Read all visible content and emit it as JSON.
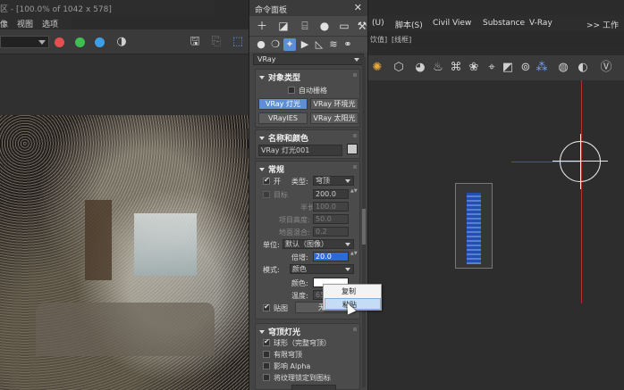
{
  "frame_buffer": {
    "title": "区 - [100.0% of 1042 x 578]",
    "menu": [
      "像",
      "视图",
      "选项"
    ]
  },
  "viewport": {
    "menu": [
      "(U)",
      "脚本(S)",
      "Civil View",
      "Substance",
      "V-Ray"
    ],
    "menu_overflow": ">> 工作区",
    "sub_header": "[线框]",
    "sub_header_prefix": "饮值]"
  },
  "command_panel": {
    "title": "命令面板",
    "close_icon": "close-icon",
    "category": "VRay",
    "object_type": {
      "header": "对象类型",
      "autogrid": "自动栅格",
      "buttons": [
        "VRay 灯光",
        "VRay 环境光",
        "VRayIES",
        "VRay 太阳光"
      ],
      "selected": "VRay 灯光"
    },
    "name_color": {
      "header": "名称和颜色",
      "name": "VRay 灯光001"
    },
    "general": {
      "header": "常规",
      "on_label": "开",
      "type_label": "类型:",
      "type_value": "穹顶",
      "target_label": "目标",
      "target_value": "200.0",
      "half_length_label": "半长:",
      "half_length_value": "100.0",
      "half_width_label": "项目高度:",
      "half_width_value": "50.0",
      "floor_label": "地面混合:",
      "floor_value": "0.2",
      "units_label": "单位:",
      "units_value": "默认（图像）",
      "multiplier_label": "倍增:",
      "multiplier_value": "20.0",
      "mode_label": "模式:",
      "mode_value": "颜色",
      "color_label": "颜色:",
      "temperature_label": "温度:",
      "temperature_value": "650",
      "texture_label": "贴图",
      "texture_button": "无贴"
    },
    "dome": {
      "header": "穹顶灯光",
      "spherical": "球形（完整穹顶）",
      "finite": "有限穹顶",
      "affect_alpha": "影响 Alpha",
      "lock_texture": "将纹理锁定到图标"
    }
  },
  "context_menu": {
    "items": [
      "复制",
      "粘贴"
    ],
    "hovered": "粘贴"
  },
  "colors": {
    "accent_blue": "#5e8fd4",
    "axis_red": "#b23030",
    "highlight": "#2b6bd6"
  }
}
